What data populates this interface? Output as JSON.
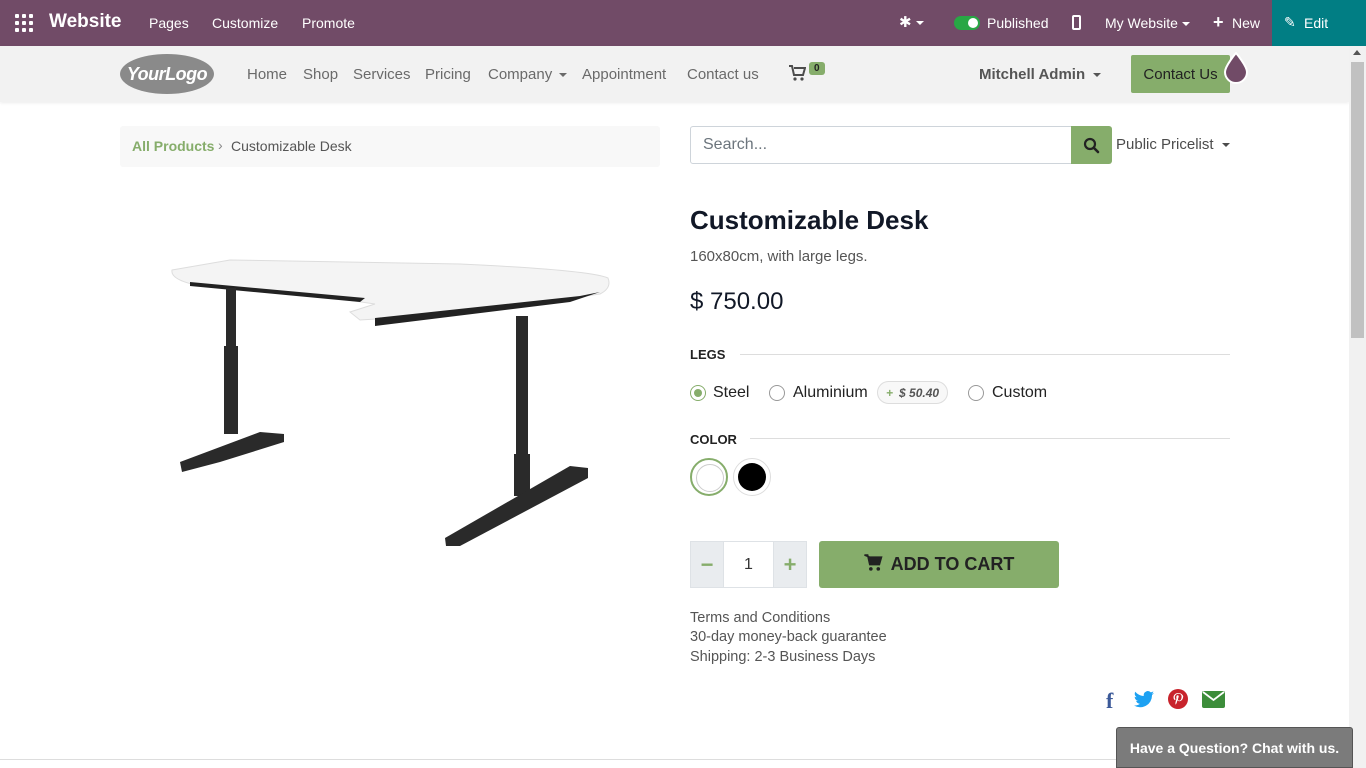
{
  "adminbar": {
    "brand": "Website",
    "menu": [
      "Pages",
      "Customize",
      "Promote"
    ],
    "published_label": "Published",
    "my_website_label": "My Website",
    "new_label": "New",
    "edit_label": "Edit",
    "color": "#714b67",
    "edit_color": "#017e84"
  },
  "header": {
    "logo_text": "YourLogo",
    "nav": [
      "Home",
      "Shop",
      "Services",
      "Pricing",
      "Company",
      "Appointment",
      "Contact us"
    ],
    "cart_count": "0",
    "user_name": "Mitchell Admin",
    "contact_button": "Contact Us"
  },
  "breadcrumb": {
    "parent": "All Products",
    "separator": "›",
    "current": "Customizable Desk"
  },
  "search": {
    "placeholder": "Search...",
    "pricelist": "Public Pricelist"
  },
  "product": {
    "name": "Customizable Desk",
    "description": "160x80cm, with large legs.",
    "price": "$ 750.00",
    "legs_label": "LEGS",
    "legs_options": [
      "Steel",
      "Aluminium",
      "Custom"
    ],
    "legs_selected": "Steel",
    "aluminium_extra_sign": "+",
    "aluminium_extra": "$ 50.40",
    "color_label": "COLOR",
    "colors": [
      "white",
      "black"
    ],
    "color_selected": "white",
    "quantity": "1",
    "add_to_cart": "ADD TO CART",
    "terms": [
      "Terms and Conditions",
      "30-day money-back guarantee",
      "Shipping: 2-3 Business Days"
    ]
  },
  "share_icons": [
    "facebook-icon",
    "twitter-icon",
    "pinterest-icon",
    "email-icon"
  ],
  "chat_label": "Have a Question? Chat with us.",
  "accent": "#86ad6b"
}
